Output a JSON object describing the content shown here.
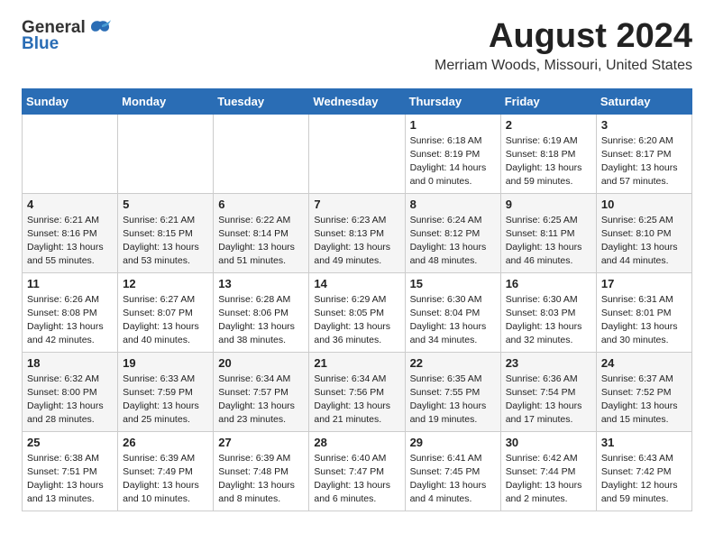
{
  "header": {
    "logo_general": "General",
    "logo_blue": "Blue",
    "title": "August 2024",
    "subtitle": "Merriam Woods, Missouri, United States"
  },
  "days_of_week": [
    "Sunday",
    "Monday",
    "Tuesday",
    "Wednesday",
    "Thursday",
    "Friday",
    "Saturday"
  ],
  "weeks": [
    [
      {
        "day": "",
        "info": ""
      },
      {
        "day": "",
        "info": ""
      },
      {
        "day": "",
        "info": ""
      },
      {
        "day": "",
        "info": ""
      },
      {
        "day": "1",
        "info": "Sunrise: 6:18 AM\nSunset: 8:19 PM\nDaylight: 14 hours\nand 0 minutes."
      },
      {
        "day": "2",
        "info": "Sunrise: 6:19 AM\nSunset: 8:18 PM\nDaylight: 13 hours\nand 59 minutes."
      },
      {
        "day": "3",
        "info": "Sunrise: 6:20 AM\nSunset: 8:17 PM\nDaylight: 13 hours\nand 57 minutes."
      }
    ],
    [
      {
        "day": "4",
        "info": "Sunrise: 6:21 AM\nSunset: 8:16 PM\nDaylight: 13 hours\nand 55 minutes."
      },
      {
        "day": "5",
        "info": "Sunrise: 6:21 AM\nSunset: 8:15 PM\nDaylight: 13 hours\nand 53 minutes."
      },
      {
        "day": "6",
        "info": "Sunrise: 6:22 AM\nSunset: 8:14 PM\nDaylight: 13 hours\nand 51 minutes."
      },
      {
        "day": "7",
        "info": "Sunrise: 6:23 AM\nSunset: 8:13 PM\nDaylight: 13 hours\nand 49 minutes."
      },
      {
        "day": "8",
        "info": "Sunrise: 6:24 AM\nSunset: 8:12 PM\nDaylight: 13 hours\nand 48 minutes."
      },
      {
        "day": "9",
        "info": "Sunrise: 6:25 AM\nSunset: 8:11 PM\nDaylight: 13 hours\nand 46 minutes."
      },
      {
        "day": "10",
        "info": "Sunrise: 6:25 AM\nSunset: 8:10 PM\nDaylight: 13 hours\nand 44 minutes."
      }
    ],
    [
      {
        "day": "11",
        "info": "Sunrise: 6:26 AM\nSunset: 8:08 PM\nDaylight: 13 hours\nand 42 minutes."
      },
      {
        "day": "12",
        "info": "Sunrise: 6:27 AM\nSunset: 8:07 PM\nDaylight: 13 hours\nand 40 minutes."
      },
      {
        "day": "13",
        "info": "Sunrise: 6:28 AM\nSunset: 8:06 PM\nDaylight: 13 hours\nand 38 minutes."
      },
      {
        "day": "14",
        "info": "Sunrise: 6:29 AM\nSunset: 8:05 PM\nDaylight: 13 hours\nand 36 minutes."
      },
      {
        "day": "15",
        "info": "Sunrise: 6:30 AM\nSunset: 8:04 PM\nDaylight: 13 hours\nand 34 minutes."
      },
      {
        "day": "16",
        "info": "Sunrise: 6:30 AM\nSunset: 8:03 PM\nDaylight: 13 hours\nand 32 minutes."
      },
      {
        "day": "17",
        "info": "Sunrise: 6:31 AM\nSunset: 8:01 PM\nDaylight: 13 hours\nand 30 minutes."
      }
    ],
    [
      {
        "day": "18",
        "info": "Sunrise: 6:32 AM\nSunset: 8:00 PM\nDaylight: 13 hours\nand 28 minutes."
      },
      {
        "day": "19",
        "info": "Sunrise: 6:33 AM\nSunset: 7:59 PM\nDaylight: 13 hours\nand 25 minutes."
      },
      {
        "day": "20",
        "info": "Sunrise: 6:34 AM\nSunset: 7:57 PM\nDaylight: 13 hours\nand 23 minutes."
      },
      {
        "day": "21",
        "info": "Sunrise: 6:34 AM\nSunset: 7:56 PM\nDaylight: 13 hours\nand 21 minutes."
      },
      {
        "day": "22",
        "info": "Sunrise: 6:35 AM\nSunset: 7:55 PM\nDaylight: 13 hours\nand 19 minutes."
      },
      {
        "day": "23",
        "info": "Sunrise: 6:36 AM\nSunset: 7:54 PM\nDaylight: 13 hours\nand 17 minutes."
      },
      {
        "day": "24",
        "info": "Sunrise: 6:37 AM\nSunset: 7:52 PM\nDaylight: 13 hours\nand 15 minutes."
      }
    ],
    [
      {
        "day": "25",
        "info": "Sunrise: 6:38 AM\nSunset: 7:51 PM\nDaylight: 13 hours\nand 13 minutes."
      },
      {
        "day": "26",
        "info": "Sunrise: 6:39 AM\nSunset: 7:49 PM\nDaylight: 13 hours\nand 10 minutes."
      },
      {
        "day": "27",
        "info": "Sunrise: 6:39 AM\nSunset: 7:48 PM\nDaylight: 13 hours\nand 8 minutes."
      },
      {
        "day": "28",
        "info": "Sunrise: 6:40 AM\nSunset: 7:47 PM\nDaylight: 13 hours\nand 6 minutes."
      },
      {
        "day": "29",
        "info": "Sunrise: 6:41 AM\nSunset: 7:45 PM\nDaylight: 13 hours\nand 4 minutes."
      },
      {
        "day": "30",
        "info": "Sunrise: 6:42 AM\nSunset: 7:44 PM\nDaylight: 13 hours\nand 2 minutes."
      },
      {
        "day": "31",
        "info": "Sunrise: 6:43 AM\nSunset: 7:42 PM\nDaylight: 12 hours\nand 59 minutes."
      }
    ]
  ]
}
